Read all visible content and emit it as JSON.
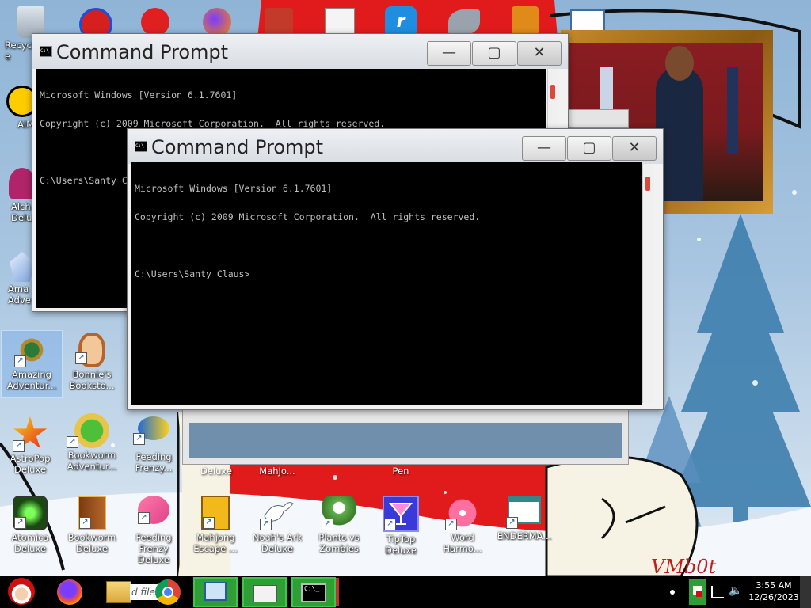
{
  "desktop": {
    "icons": [
      {
        "label": "Recycle",
        "icon": "recycle-bin-icon"
      },
      {
        "label": "AIM",
        "icon": "aim-icon"
      },
      {
        "label": "Alch Delu",
        "icon": "alchemy-icon"
      },
      {
        "label": "Ama Adve",
        "icon": "gem-icon"
      },
      {
        "label": "Amazing Adventur...",
        "icon": "compass-globe-icon"
      },
      {
        "label": "Bonnie's Booksto...",
        "icon": "bonnie-face-icon"
      },
      {
        "label": "AstroPop Deluxe",
        "icon": "astropop-icon"
      },
      {
        "label": "Bookworm Adventur...",
        "icon": "bookworm-icon"
      },
      {
        "label": "Feeding Frenzy...",
        "icon": "fish-icon"
      },
      {
        "label": "Deluxe",
        "icon": ""
      },
      {
        "label": "MahJo...",
        "icon": ""
      },
      {
        "label": "Pen",
        "icon": ""
      },
      {
        "label": "Atomica Deluxe",
        "icon": "atomica-icon"
      },
      {
        "label": "Bookworm Deluxe",
        "icon": "book-icon"
      },
      {
        "label": "Feeding Frenzy Deluxe",
        "icon": "fish-icon"
      },
      {
        "label": "Mahjong Escape ...",
        "icon": "mahjong-tile-icon"
      },
      {
        "label": "Noah's Ark Deluxe",
        "icon": "dove-icon"
      },
      {
        "label": "Plants vs Zombies",
        "icon": "flower-pot-icon"
      },
      {
        "label": "TipTop Deluxe",
        "icon": "cocktail-icon"
      },
      {
        "label": "Word Harmo...",
        "icon": "pink-flower-icon"
      },
      {
        "label": "ENDERMA...",
        "icon": "window-app-icon"
      }
    ],
    "wall_text": "VMb0t"
  },
  "cmd_windows": [
    {
      "title": "Command Prompt",
      "lines": [
        "Microsoft Windows [Version 6.1.7601]",
        "Copyright (c) 2009 Microsoft Corporation.  All rights reserved.",
        "",
        "C:\\Users\\Santy Claus>"
      ]
    },
    {
      "title": "Command Prompt",
      "lines": [
        "Microsoft Windows [Version 6.1.7601]",
        "Copyright (c) 2009 Microsoft Corporation.  All rights reserved.",
        "",
        "C:\\Users\\Santy Claus>"
      ]
    }
  ],
  "window_controls": {
    "minimize": "—",
    "maximize": "▢",
    "close": "✕"
  },
  "taskbar": {
    "pinned": [
      {
        "name": "santa-start-icon"
      },
      {
        "name": "firefox-icon"
      },
      {
        "name": "file-explorer-icon",
        "label": "d files"
      },
      {
        "name": "chrome-icon"
      },
      {
        "name": "remote-desktop-icon"
      },
      {
        "name": "mail-icon"
      },
      {
        "name": "cmd-icon"
      }
    ],
    "clock": {
      "time": "3:55 AM",
      "date": "12/26/2023"
    }
  },
  "colors": {
    "taskbar_active": "#2f9e37",
    "console_bg": "#000000",
    "console_fg": "#c0c0c0",
    "scroll_thumb": "#d94a3a"
  }
}
